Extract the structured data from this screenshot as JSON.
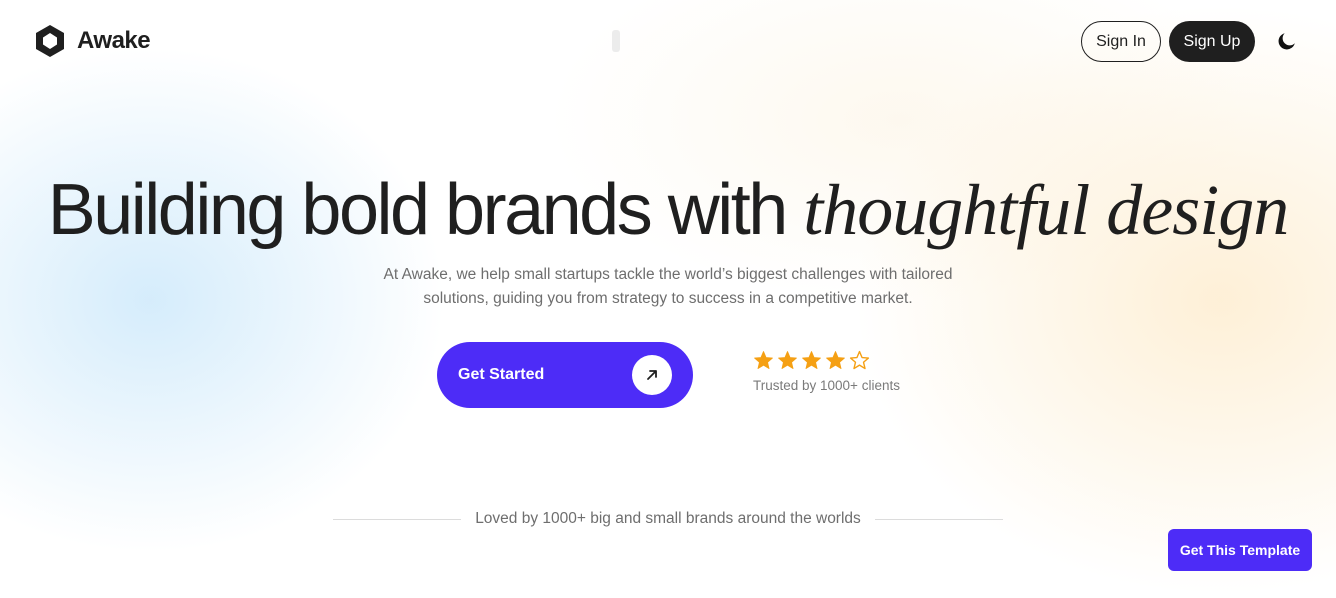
{
  "brand": {
    "name": "Awake",
    "logo_icon": "hexagon-logo-icon"
  },
  "nav": {
    "sign_in": "Sign In",
    "sign_up": "Sign Up",
    "theme_icon": "moon-icon"
  },
  "hero": {
    "headline_plain": "Building bold brands with ",
    "headline_accent": "thoughtful design",
    "subtext": "At Awake, we help small startups tackle the world’s biggest challenges with tailored solutions, guiding you from strategy to success in a competitive market.",
    "cta_label": "Get Started",
    "cta_icon": "arrow-up-right-icon"
  },
  "rating": {
    "stars_filled": 4,
    "stars_total": 5,
    "label": "Trusted by 1000+ clients"
  },
  "loved_text": "Loved by 1000+ big and small brands around the worlds",
  "template_button": "Get This Template",
  "colors": {
    "primary": "#4d2cf7",
    "dark": "#1f1f1f",
    "star": "#f5a014",
    "muted_text": "#6e6e6e"
  }
}
